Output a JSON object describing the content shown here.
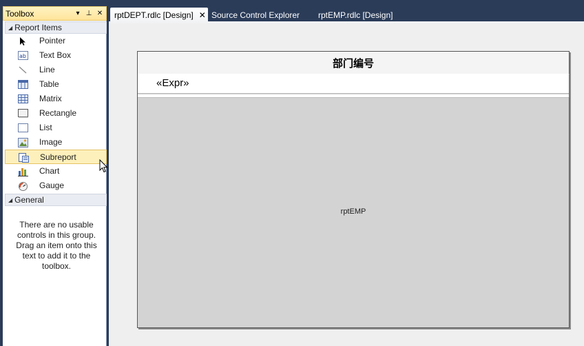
{
  "toolbox": {
    "title": "Toolbox",
    "buttons": {
      "dropdown": "▾",
      "pin": "⊥",
      "close": "✕"
    },
    "groups": [
      {
        "label": "Report Items",
        "items": [
          {
            "label": "Pointer",
            "icon": "pointer-icon"
          },
          {
            "label": "Text Box",
            "icon": "textbox-icon"
          },
          {
            "label": "Line",
            "icon": "line-icon"
          },
          {
            "label": "Table",
            "icon": "table-icon"
          },
          {
            "label": "Matrix",
            "icon": "matrix-icon"
          },
          {
            "label": "Rectangle",
            "icon": "rectangle-icon"
          },
          {
            "label": "List",
            "icon": "list-icon"
          },
          {
            "label": "Image",
            "icon": "image-icon"
          },
          {
            "label": "Subreport",
            "icon": "subreport-icon",
            "selected": true
          },
          {
            "label": "Chart",
            "icon": "chart-icon"
          },
          {
            "label": "Gauge",
            "icon": "gauge-icon"
          }
        ]
      },
      {
        "label": "General",
        "message": "There are no usable controls in this group. Drag an item onto this text to add it to the toolbox."
      }
    ]
  },
  "tabs": [
    {
      "label": "rptDEPT.rdlc [Design]",
      "active": true,
      "close": "✕"
    },
    {
      "label": "Source Control Explorer",
      "active": false
    },
    {
      "label": "rptEMP.rdlc [Design]",
      "active": false
    }
  ],
  "report": {
    "header_text": "部门编号",
    "expr_text": "«Expr»",
    "subreport_name": "rptEMP"
  },
  "colors": {
    "chrome": "#2b3c59",
    "selection": "#fdf0bb",
    "selection_border": "#e5c365",
    "subreport_fill": "#d3d3d3"
  }
}
